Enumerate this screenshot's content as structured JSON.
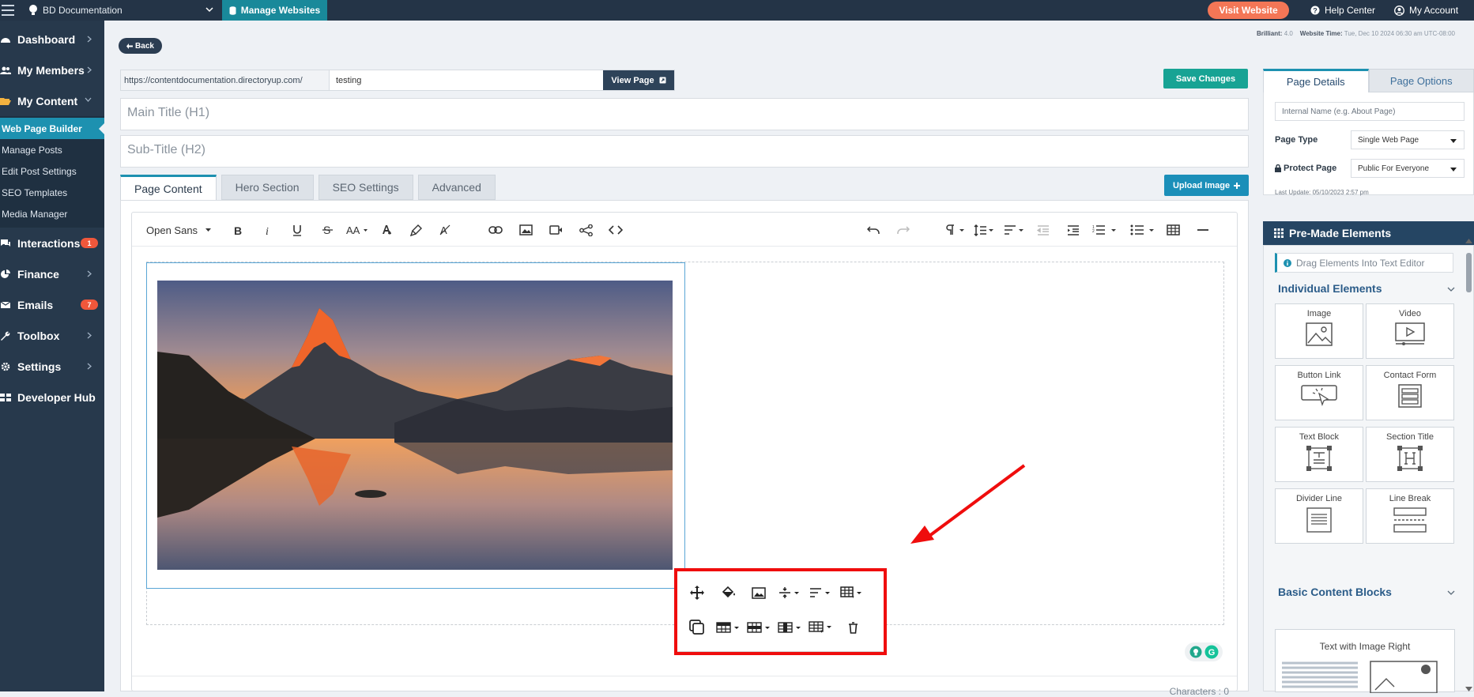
{
  "topbar": {
    "site_name": "BD Documentation",
    "manage_label": "Manage Websites",
    "visit_label": "Visit Website",
    "help_label": "Help Center",
    "account_label": "My Account"
  },
  "sidebar": {
    "items": [
      {
        "label": "Dashboard"
      },
      {
        "label": "My Members"
      },
      {
        "label": "My Content"
      },
      {
        "label": "Interactions",
        "badge": "1"
      },
      {
        "label": "Finance"
      },
      {
        "label": "Emails",
        "badge": "7"
      },
      {
        "label": "Toolbox"
      },
      {
        "label": "Settings"
      },
      {
        "label": "Developer Hub"
      }
    ],
    "sub_items": [
      {
        "label": "Web Page Builder"
      },
      {
        "label": "Manage Posts"
      },
      {
        "label": "Edit Post Settings"
      },
      {
        "label": "SEO Templates"
      },
      {
        "label": "Media Manager"
      }
    ]
  },
  "header": {
    "back_label": "Back",
    "meta_brilliant_label": "Brilliant:",
    "meta_brilliant_value": "4.0",
    "meta_time_label": "Website Time:",
    "meta_time_value": "Tue, Dec 10 2024 06:30 am UTC-08:00"
  },
  "page": {
    "url_prefix": "https://contentdocumentation.directoryup.com/",
    "url_value": "testing",
    "view_label": "View Page",
    "save_label": "Save Changes",
    "main_title_placeholder": "Main Title (H1)",
    "sub_title_placeholder": "Sub-Title (H2)"
  },
  "tabs": [
    "Page Content",
    "Hero Section",
    "SEO Settings",
    "Advanced"
  ],
  "upload_label": "Upload Image",
  "editor": {
    "font_name": "Open Sans",
    "char_count": "Characters : 0"
  },
  "right_panel": {
    "tabs": [
      "Page Details",
      "Page Options"
    ],
    "internal_name_placeholder": "Internal Name (e.g. About Page)",
    "page_type_label": "Page Type",
    "page_type_value": "Single Web Page",
    "protect_label": "Protect Page",
    "protect_value": "Public For Everyone",
    "last_update": "Last Update: 05/10/2023 2:57 pm"
  },
  "premade": {
    "title": "Pre-Made Elements",
    "drag_hint": "Drag Elements Into Text Editor",
    "individual_title": "Individual Elements",
    "elements": [
      "Image",
      "Video",
      "Button Link",
      "Contact Form",
      "Text Block",
      "Section Title",
      "Divider Line",
      "Line Break"
    ],
    "basic_title": "Basic Content Blocks",
    "basic_first": "Text with Image Right"
  },
  "colors": {
    "sidebar": "#27394c",
    "accent": "#1d91b0",
    "save": "#17a394",
    "visit": "#f47656",
    "highlight": "#ef0d0d"
  }
}
